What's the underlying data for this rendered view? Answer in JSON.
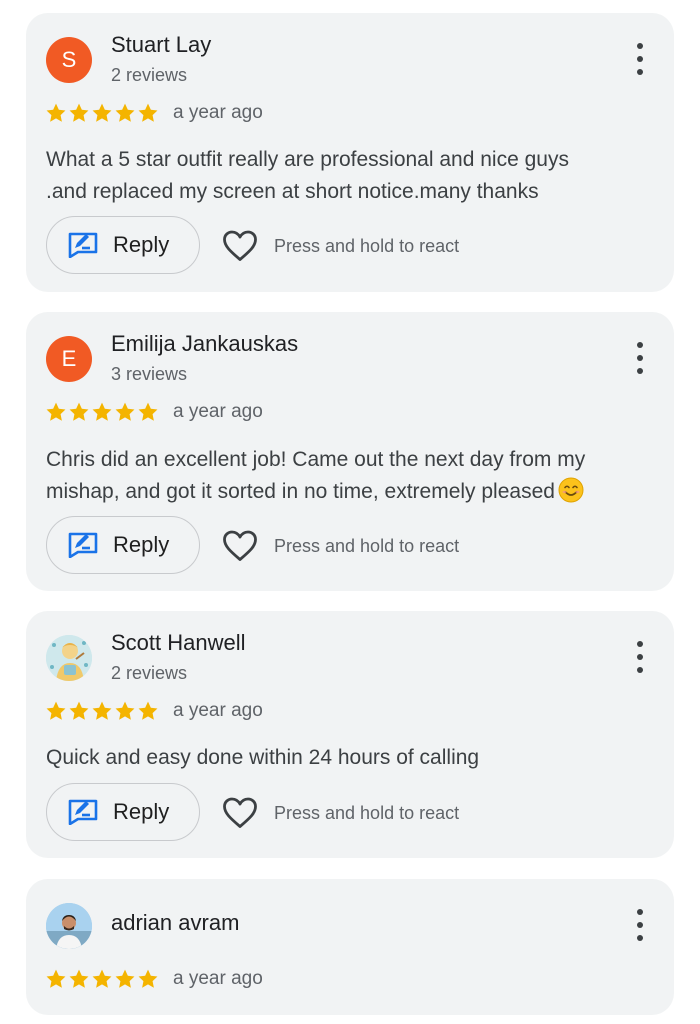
{
  "colors": {
    "star": "#f4b400",
    "card_background": "#f1f3f4",
    "avatar_letter_background": "#f15a24",
    "reply_icon": "#1a73e8"
  },
  "reviews": [
    {
      "avatar_letter": "S",
      "name": "Stuart Lay",
      "review_count": "2 reviews",
      "stars": 5,
      "time": "a year ago",
      "text_lines": [
        "What a 5 star outfit really are professional and nice guys",
        ".and replaced my screen at short notice.many thanks"
      ],
      "reply_label": "Reply",
      "react_label": "Press and hold to react"
    },
    {
      "avatar_letter": "E",
      "name": "Emilija Jankauskas",
      "review_count": "3 reviews",
      "stars": 5,
      "time": "a year ago",
      "text_lines": [
        "Chris did an excellent job! Came out the next day from my",
        "mishap, and got it sorted in no time, extremely pleased"
      ],
      "text_emoji": "smiling-face-emoji",
      "reply_label": "Reply",
      "react_label": "Press and hold to react"
    },
    {
      "avatar_icon": "profile-photo-illustration",
      "name": "Scott Hanwell",
      "review_count": "2 reviews",
      "stars": 5,
      "time": "a year ago",
      "text_lines": [
        "Quick and easy done within 24 hours of calling"
      ],
      "reply_label": "Reply",
      "react_label": "Press and hold to react"
    },
    {
      "avatar_icon": "profile-photo-person",
      "name": "adrian avram",
      "stars": 5,
      "time": "a year ago"
    }
  ],
  "icons": {
    "reply": "reply-edit-icon",
    "react": "heart-outline-icon",
    "menu": "more-vertical-icon",
    "star": "star-icon"
  }
}
